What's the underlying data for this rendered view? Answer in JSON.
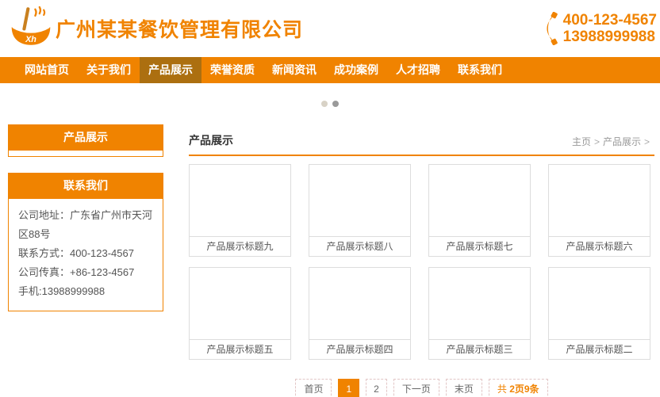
{
  "colors": {
    "accent": "#f08300",
    "nav_active_bg": "#ac6f10"
  },
  "header": {
    "logo_text": "Xh",
    "company_name": "广州某某餐饮管理有限公司",
    "phone_line1": "400-123-4567",
    "phone_line2": "13988999988"
  },
  "nav": {
    "items": [
      {
        "label": "网站首页",
        "active": false
      },
      {
        "label": "关于我们",
        "active": false
      },
      {
        "label": "产品展示",
        "active": true
      },
      {
        "label": "荣誉资质",
        "active": false
      },
      {
        "label": "新闻资讯",
        "active": false
      },
      {
        "label": "成功案例",
        "active": false
      },
      {
        "label": "人才招聘",
        "active": false
      },
      {
        "label": "联系我们",
        "active": false
      }
    ]
  },
  "carousel": {
    "dot_count": 2,
    "active_dot_index": 1
  },
  "sidebar": {
    "product_box_title": "产品展示",
    "contact_box_title": "联系我们",
    "contact_lines": [
      "公司地址：广东省广州市天河区88号",
      "联系方式：400-123-4567",
      "公司传真：+86-123-4567",
      "手机:13988999988"
    ]
  },
  "main": {
    "title": "产品展示",
    "breadcrumb": {
      "home": "主页",
      "separator": ">",
      "current": "产品展示"
    },
    "products": [
      "产品展示标题九",
      "产品展示标题八",
      "产品展示标题七",
      "产品展示标题六",
      "产品展示标题五",
      "产品展示标题四",
      "产品展示标题三",
      "产品展示标题二"
    ],
    "pagination": {
      "first": "首页",
      "page1": "1",
      "page2": "2",
      "next": "下一页",
      "last": "末页",
      "total_prefix": "共 ",
      "total_bold": "2页9条"
    }
  }
}
